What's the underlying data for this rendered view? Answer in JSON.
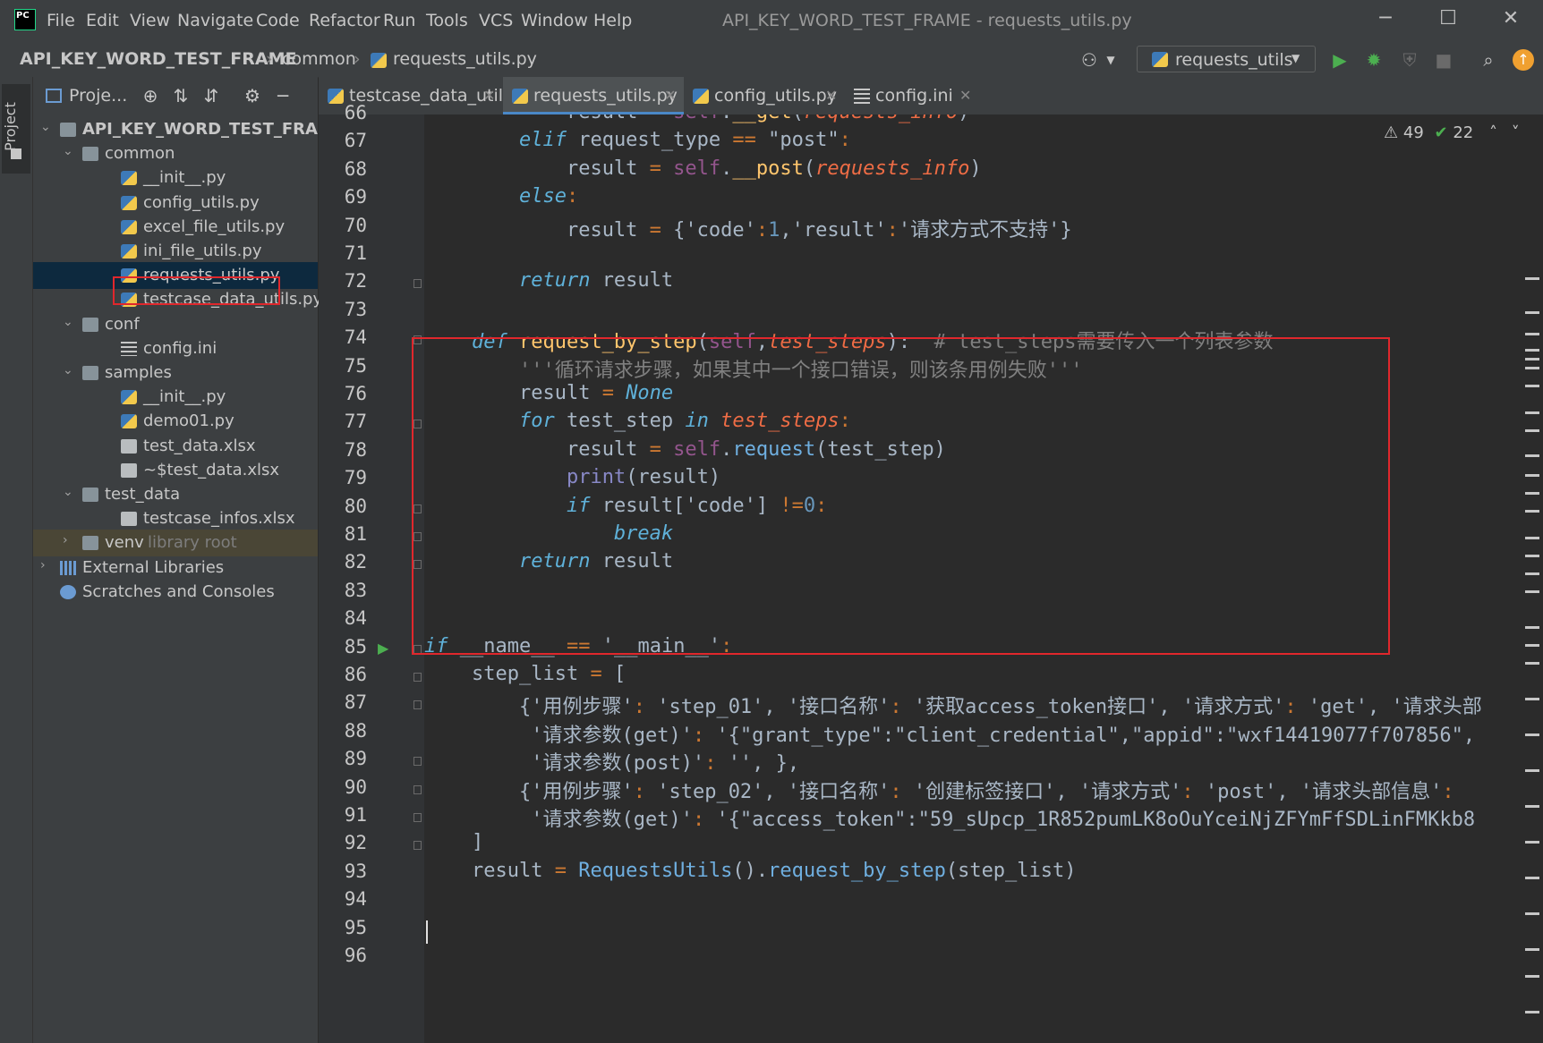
{
  "menu": [
    "File",
    "Edit",
    "View",
    "Navigate",
    "Code",
    "Refactor",
    "Run",
    "Tools",
    "VCS",
    "Window",
    "Help"
  ],
  "window_title": "API_KEY_WORD_TEST_FRAME - requests_utils.py",
  "window_controls": {
    "minimize": "─",
    "maximize": "☐",
    "close": "✕"
  },
  "breadcrumb": [
    "API_KEY_WORD_TEST_FRAME",
    "common",
    "requests_utils.py"
  ],
  "run_config": "requests_utils",
  "project_panel": {
    "title": "Proje...",
    "tab_label": "Project"
  },
  "tree": [
    {
      "label": "API_KEY_WORD_TEST_FRAM",
      "indent": 0,
      "type": "folder",
      "arrow": "⌄"
    },
    {
      "label": "common",
      "indent": 1,
      "type": "folder",
      "arrow": "⌄"
    },
    {
      "label": "__init__.py",
      "indent": 2,
      "type": "py"
    },
    {
      "label": "config_utils.py",
      "indent": 2,
      "type": "py"
    },
    {
      "label": "excel_file_utils.py",
      "indent": 2,
      "type": "py"
    },
    {
      "label": "ini_file_utils.py",
      "indent": 2,
      "type": "py"
    },
    {
      "label": "requests_utils.py",
      "indent": 2,
      "type": "py",
      "selected": true
    },
    {
      "label": "testcase_data_utils.py",
      "indent": 2,
      "type": "py"
    },
    {
      "label": "conf",
      "indent": 1,
      "type": "folder",
      "arrow": "⌄"
    },
    {
      "label": "config.ini",
      "indent": 2,
      "type": "ini"
    },
    {
      "label": "samples",
      "indent": 1,
      "type": "folder",
      "arrow": "⌄"
    },
    {
      "label": "__init__.py",
      "indent": 2,
      "type": "py"
    },
    {
      "label": "demo01.py",
      "indent": 2,
      "type": "py"
    },
    {
      "label": "test_data.xlsx",
      "indent": 2,
      "type": "xl"
    },
    {
      "label": "~$test_data.xlsx",
      "indent": 2,
      "type": "xl"
    },
    {
      "label": "test_data",
      "indent": 1,
      "type": "folder",
      "arrow": "⌄"
    },
    {
      "label": "testcase_infos.xlsx",
      "indent": 2,
      "type": "xl"
    },
    {
      "label": "venv",
      "indent": 1,
      "type": "folder",
      "arrow": "›",
      "hint": "library root",
      "venv": true
    },
    {
      "label": "External Libraries",
      "indent": 0,
      "type": "lib",
      "arrow": "›"
    },
    {
      "label": "Scratches and Consoles",
      "indent": 0,
      "type": "scr"
    }
  ],
  "tabs": [
    {
      "label": "testcase_data_utils.py",
      "type": "py"
    },
    {
      "label": "requests_utils.py",
      "type": "py",
      "active": true
    },
    {
      "label": "config_utils.py",
      "type": "py"
    },
    {
      "label": "config.ini",
      "type": "ini"
    }
  ],
  "inspections": {
    "warnings": "49",
    "ok": "22"
  },
  "code_lines": [
    {
      "n": "66",
      "i": 3,
      "t": [
        [
          "nm",
          "result "
        ],
        [
          "op",
          "= "
        ],
        [
          "sf",
          "self"
        ],
        [
          "nm",
          "."
        ],
        [
          "fn",
          "__get"
        ],
        [
          "nm",
          "("
        ],
        [
          "pr",
          "requests_info"
        ],
        [
          "nm",
          ")"
        ]
      ]
    },
    {
      "n": "67",
      "i": 2,
      "t": [
        [
          "kb",
          "elif "
        ],
        [
          "nm",
          "request_type "
        ],
        [
          "op",
          "== "
        ],
        [
          "nm",
          "\"post\""
        ],
        [
          "op",
          ":"
        ]
      ]
    },
    {
      "n": "68",
      "i": 3,
      "t": [
        [
          "nm",
          "result "
        ],
        [
          "op",
          "= "
        ],
        [
          "sf",
          "self"
        ],
        [
          "nm",
          "."
        ],
        [
          "fn",
          "__post"
        ],
        [
          "nm",
          "("
        ],
        [
          "pr",
          "requests_info"
        ],
        [
          "nm",
          ")"
        ]
      ]
    },
    {
      "n": "69",
      "i": 2,
      "t": [
        [
          "kb",
          "else"
        ],
        [
          "op",
          ":"
        ]
      ]
    },
    {
      "n": "70",
      "i": 3,
      "t": [
        [
          "nm",
          "result "
        ],
        [
          "op",
          "= "
        ],
        [
          "nm",
          "{'code'"
        ],
        [
          "op",
          ":"
        ],
        [
          "num",
          "1"
        ],
        [
          "nm",
          ",'result'"
        ],
        [
          "op",
          ":"
        ],
        [
          "nm",
          "'请求方式不支持'}"
        ]
      ]
    },
    {
      "n": "71",
      "i": 0,
      "t": []
    },
    {
      "n": "72",
      "i": 2,
      "t": [
        [
          "kb",
          "return "
        ],
        [
          "nm",
          "result"
        ]
      ]
    },
    {
      "n": "73",
      "i": 0,
      "t": []
    },
    {
      "n": "74",
      "i": 1,
      "t": [
        [
          "kb",
          "def "
        ],
        [
          "fn",
          "request_by_step"
        ],
        [
          "nm",
          "("
        ],
        [
          "sf",
          "self"
        ],
        [
          "nm",
          ","
        ],
        [
          "pr",
          "test_steps"
        ],
        [
          "nm",
          "):  "
        ],
        [
          "cm",
          "# test_steps需要传入一个列表参数"
        ]
      ]
    },
    {
      "n": "75",
      "i": 2,
      "t": [
        [
          "cm",
          "'''循环请求步骤，如果其中一个接口错误，则该条用例失败'''"
        ]
      ]
    },
    {
      "n": "76",
      "i": 2,
      "t": [
        [
          "nm",
          "result "
        ],
        [
          "op",
          "= "
        ],
        [
          "kb",
          "None"
        ]
      ]
    },
    {
      "n": "77",
      "i": 2,
      "t": [
        [
          "kb",
          "for "
        ],
        [
          "nm",
          "test_step "
        ],
        [
          "kb",
          "in "
        ],
        [
          "pr",
          "test_steps"
        ],
        [
          "op",
          ":"
        ]
      ]
    },
    {
      "n": "78",
      "i": 3,
      "t": [
        [
          "nm",
          "result "
        ],
        [
          "op",
          "= "
        ],
        [
          "sf",
          "self"
        ],
        [
          "nm",
          "."
        ],
        [
          "cls",
          "request"
        ],
        [
          "nm",
          "(test_step)"
        ]
      ]
    },
    {
      "n": "79",
      "i": 3,
      "t": [
        [
          "bi",
          "print"
        ],
        [
          "nm",
          "(result)"
        ]
      ]
    },
    {
      "n": "80",
      "i": 3,
      "t": [
        [
          "kb",
          "if "
        ],
        [
          "nm",
          "result['code'] "
        ],
        [
          "op",
          "!="
        ],
        [
          "num",
          "0"
        ],
        [
          "op",
          ":"
        ]
      ]
    },
    {
      "n": "81",
      "i": 4,
      "t": [
        [
          "kb",
          "break"
        ]
      ]
    },
    {
      "n": "82",
      "i": 2,
      "t": [
        [
          "kb",
          "return "
        ],
        [
          "nm",
          "result"
        ]
      ]
    },
    {
      "n": "83",
      "i": 0,
      "t": []
    },
    {
      "n": "84",
      "i": 0,
      "t": []
    },
    {
      "n": "85",
      "i": 0,
      "t": [
        [
          "kb",
          "if "
        ],
        [
          "nm",
          "__name__ "
        ],
        [
          "op",
          "== "
        ],
        [
          "nm",
          "'__main__'"
        ],
        [
          "op",
          ":"
        ]
      ]
    },
    {
      "n": "86",
      "i": 1,
      "t": [
        [
          "nm",
          "step_list "
        ],
        [
          "op",
          "= "
        ],
        [
          "nm",
          "["
        ]
      ]
    },
    {
      "n": "87",
      "i": 2,
      "t": [
        [
          "nm",
          "{'用例步骤'"
        ],
        [
          "op",
          ": "
        ],
        [
          "nm",
          "'step_01', '接口名称'"
        ],
        [
          "op",
          ": "
        ],
        [
          "nm",
          "'获取access_token接口', '请求方式'"
        ],
        [
          "op",
          ": "
        ],
        [
          "nm",
          "'get', '请求头部"
        ]
      ]
    },
    {
      "n": "88",
      "i": 2,
      "x": " ",
      "t": [
        [
          "nm",
          "'请求参数(get)'"
        ],
        [
          "op",
          ": "
        ],
        [
          "nm",
          "'{\"grant_type\":\"client_credential\",\"appid\":\"wxf14419077f707856\","
        ]
      ]
    },
    {
      "n": "89",
      "i": 2,
      "x": " ",
      "t": [
        [
          "nm",
          "'请求参数(post)'"
        ],
        [
          "op",
          ": "
        ],
        [
          "nm",
          "'', },"
        ]
      ]
    },
    {
      "n": "90",
      "i": 2,
      "t": [
        [
          "nm",
          "{'用例步骤'"
        ],
        [
          "op",
          ": "
        ],
        [
          "nm",
          "'step_02', '接口名称'"
        ],
        [
          "op",
          ": "
        ],
        [
          "nm",
          "'创建标签接口', '请求方式'"
        ],
        [
          "op",
          ": "
        ],
        [
          "nm",
          "'post', '请求头部信息'"
        ],
        [
          "op",
          ":"
        ]
      ]
    },
    {
      "n": "91",
      "i": 2,
      "x": " ",
      "t": [
        [
          "nm",
          "'请求参数(get)'"
        ],
        [
          "op",
          ": "
        ],
        [
          "nm",
          "'{\"access_token\":\"59_sUpcp_1R852pumLK8oOuYceiNjZFYmFfSDLinFMKkb8"
        ]
      ]
    },
    {
      "n": "92",
      "i": 1,
      "t": [
        [
          "nm",
          "]"
        ]
      ]
    },
    {
      "n": "93",
      "i": 1,
      "t": [
        [
          "nm",
          "result "
        ],
        [
          "op",
          "= "
        ],
        [
          "cls",
          "RequestsUtils"
        ],
        [
          "nm",
          "()."
        ],
        [
          "cls",
          "request_by_step"
        ],
        [
          "nm",
          "(step_list)"
        ]
      ]
    },
    {
      "n": "94",
      "i": 0,
      "t": []
    },
    {
      "n": "95",
      "i": 0,
      "t": []
    },
    {
      "n": "96",
      "i": 0,
      "t": []
    }
  ],
  "colors": {
    "accent": "#4a88c7",
    "highlight_box": "#e0272c",
    "run": "#4caf50"
  }
}
